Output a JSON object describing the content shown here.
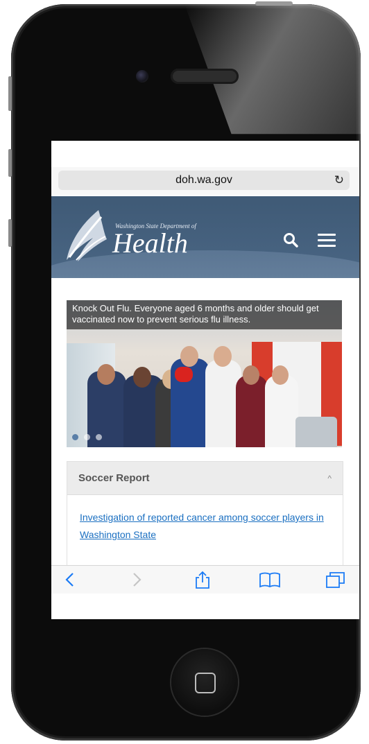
{
  "browser": {
    "url": "doh.wa.gov",
    "reload_glyph": "↻"
  },
  "header": {
    "logo_small_text": "Washington State Department of",
    "logo_big_text": "Health",
    "colors": {
      "header_bg": "#43607d",
      "accent": "#ffffff"
    }
  },
  "hero": {
    "caption": "Knock Out Flu. Everyone aged 6 months and older should get vaccinated now to prevent serious flu illness.",
    "slide_count": 3,
    "active_slide": 1
  },
  "accordion": {
    "title": "Soccer Report",
    "chevron_glyph": "^",
    "link_text": "Investigation of reported cancer among soccer players in Washington State",
    "link_color": "#1a6fc1"
  },
  "toolbar": {
    "back_glyph": "<",
    "forward_glyph": ">",
    "icons": [
      "back-icon",
      "forward-icon",
      "share-icon",
      "bookmarks-icon",
      "tabs-icon"
    ]
  }
}
